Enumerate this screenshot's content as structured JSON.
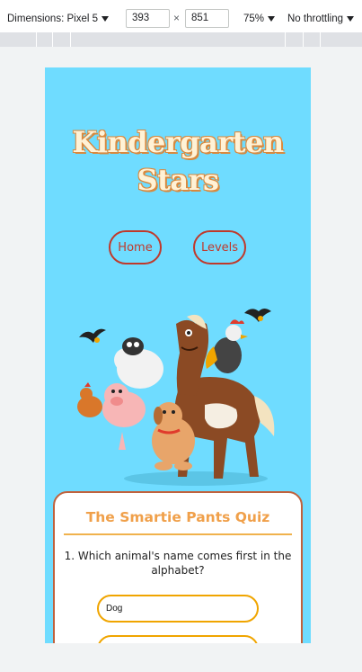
{
  "devtools": {
    "dimensions_label": "Dimensions: Pixel 5",
    "width": "393",
    "times": "×",
    "height": "851",
    "zoom": "75%",
    "throttling": "No throttling"
  },
  "site": {
    "title": "Kindergarten Stars",
    "nav": [
      "Home",
      "Levels"
    ]
  },
  "quiz": {
    "title": "The Smartie Pants Quiz",
    "question": "1. Which animal's name comes first in the alphabet?",
    "answers": [
      "Dog",
      ""
    ]
  },
  "colors": {
    "background": "#6fdcff",
    "accent_red": "#c0392b",
    "accent_orange": "#f0a04a"
  }
}
